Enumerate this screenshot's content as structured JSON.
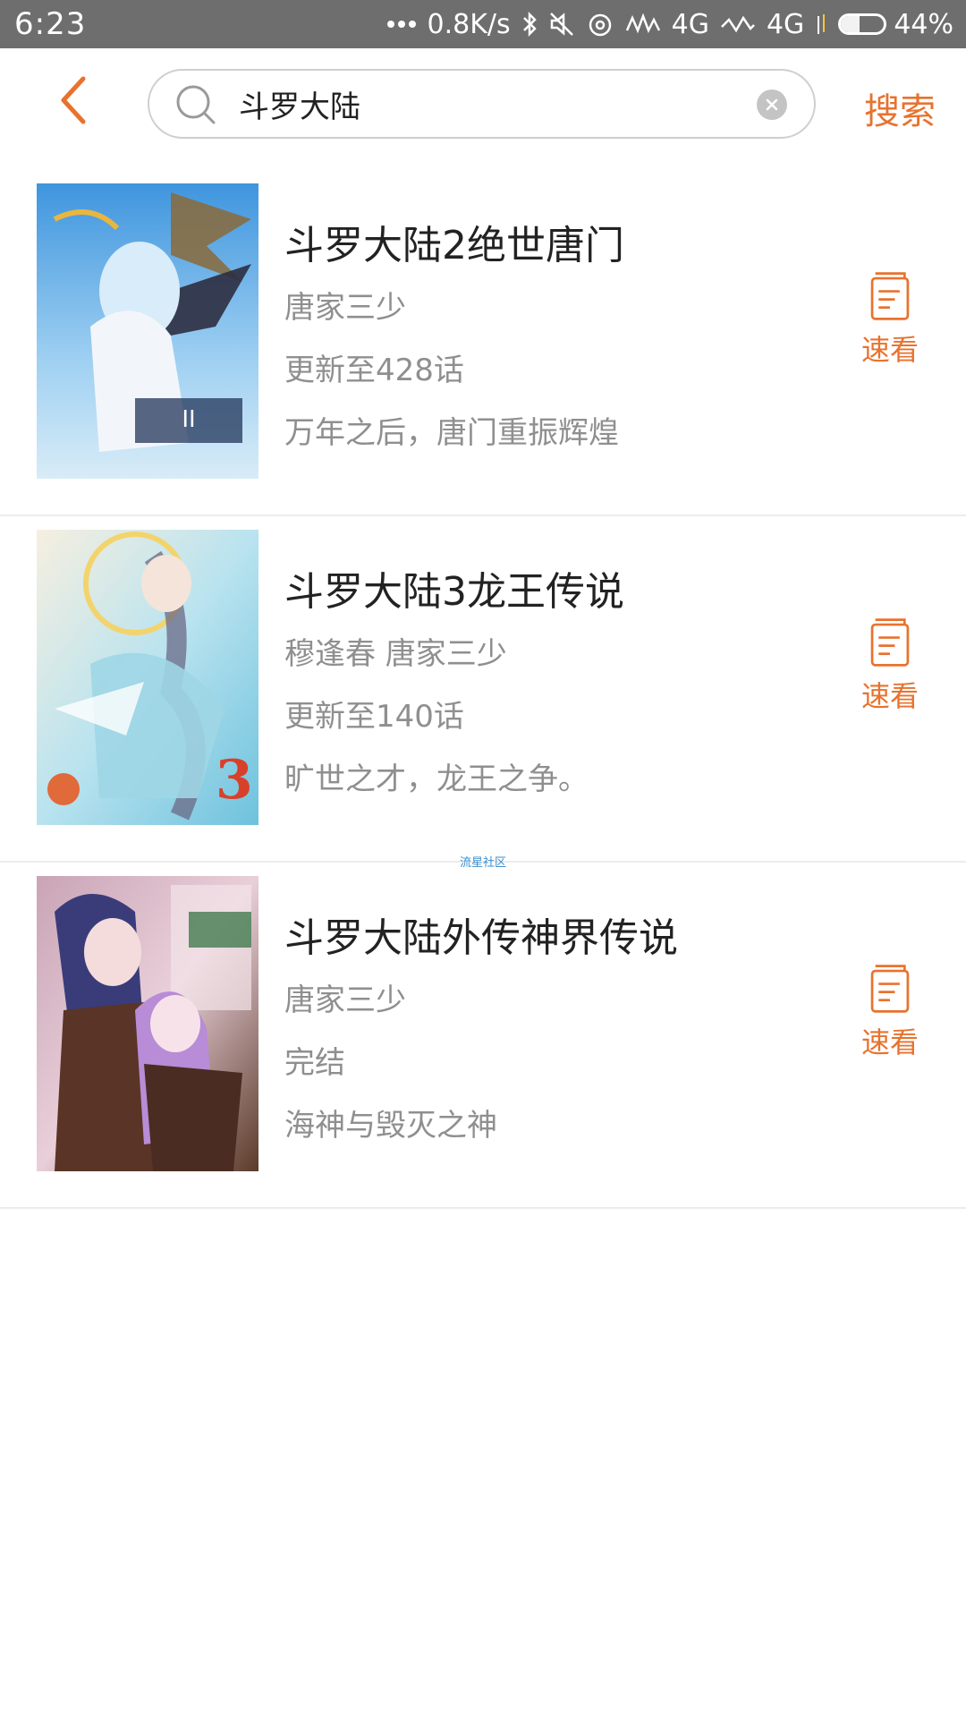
{
  "status_bar": {
    "time": "6:23",
    "net_speed": "0.8K/s",
    "signal1": "4G",
    "signal2": "4G",
    "battery_percent": "44%",
    "battery_level": 0.44
  },
  "header": {
    "search_value": "斗罗大陆",
    "search_button": "搜索"
  },
  "results": [
    {
      "title": "斗罗大陆2绝世唐门",
      "author": "唐家三少",
      "status": "更新至428话",
      "description": "万年之后，唐门重振辉煌",
      "action_label": "速看",
      "cover_palette": [
        "#5aa8e6",
        "#cfe6f7",
        "#3b3b55"
      ]
    },
    {
      "title": "斗罗大陆3龙王传说",
      "author": "穆逢春 唐家三少",
      "status": "更新至140话",
      "description": "旷世之才，龙王之争。",
      "action_label": "速看",
      "cover_palette": [
        "#8fd3e8",
        "#f3e7d8",
        "#7a6a8e"
      ]
    },
    {
      "title": "斗罗大陆外传神界传说",
      "author": "唐家三少",
      "status": "完结",
      "description": "海神与毁灭之神",
      "action_label": "速看",
      "cover_palette": [
        "#5c3a4e",
        "#e8b7d6",
        "#3e2a5c"
      ]
    }
  ],
  "watermark": "流星社区",
  "colors": {
    "accent": "#e8722e",
    "status_bar_bg": "#6e6e6e",
    "muted_text": "#8f8f8f"
  }
}
